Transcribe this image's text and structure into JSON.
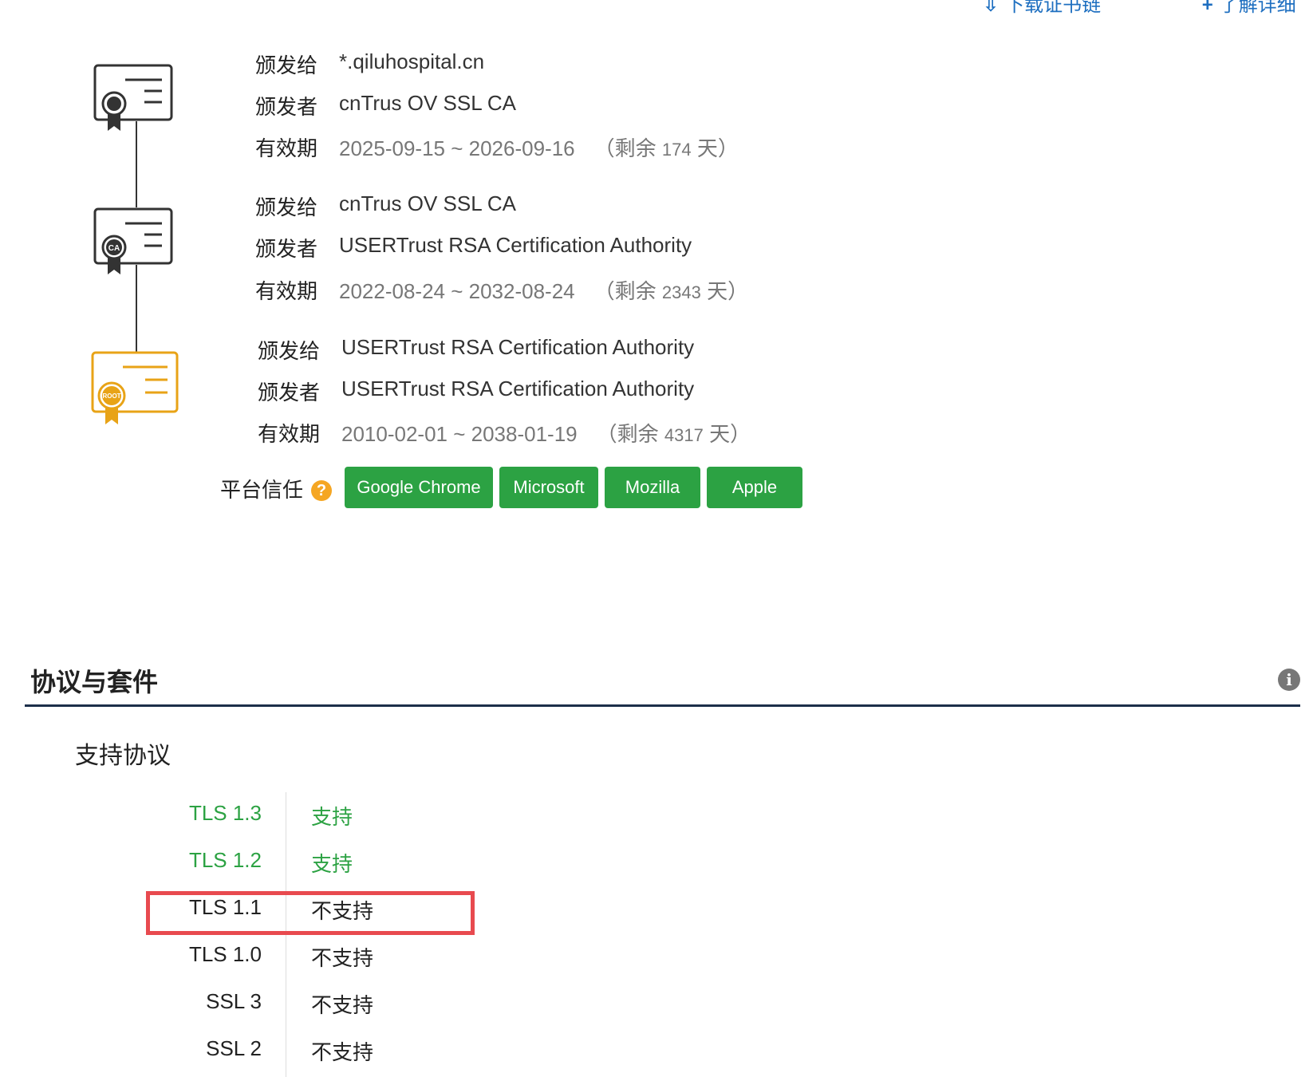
{
  "top_links": [
    {
      "icon": "download-icon",
      "label": "下载证书链"
    },
    {
      "icon": "plus-icon",
      "label": "了解详细"
    }
  ],
  "chain": [
    {
      "icon": "certificate-icon",
      "rows": [
        {
          "label": "颁发给",
          "value": "*.qiluhospital.cn"
        },
        {
          "label": "颁发者",
          "value": "cnTrus OV SSL CA"
        },
        {
          "label": "有效期",
          "value": "2025-09-15 ~ 2026-09-16",
          "remain_prefix": "（剩余",
          "remain_days": "174",
          "remain_suffix": "天）"
        }
      ]
    },
    {
      "icon": "ca-certificate-icon",
      "seal": "CA",
      "rows": [
        {
          "label": "颁发给",
          "value": "cnTrus OV SSL CA"
        },
        {
          "label": "颁发者",
          "value": "USERTrust RSA Certification Authority"
        },
        {
          "label": "有效期",
          "value": "2022-08-24 ~ 2032-08-24",
          "remain_prefix": "（剩余",
          "remain_days": "2343",
          "remain_suffix": "天）"
        }
      ]
    },
    {
      "icon": "root-certificate-icon",
      "seal": "ROOT",
      "rows": [
        {
          "label": "颁发给",
          "value": "USERTrust RSA Certification Authority"
        },
        {
          "label": "颁发者",
          "value": "USERTrust RSA Certification Authority"
        },
        {
          "label": "有效期",
          "value": "2010-02-01 ~ 2038-01-19",
          "remain_prefix": "（剩余",
          "remain_days": "4317",
          "remain_suffix": "天）"
        }
      ]
    }
  ],
  "trust": {
    "label": "平台信任",
    "help_glyph": "?",
    "platforms": [
      "Google Chrome",
      "Microsoft",
      "Mozilla",
      "Apple"
    ]
  },
  "section": {
    "title": "协议与套件",
    "info_glyph": "i",
    "subtitle": "支持协议"
  },
  "protocols": [
    {
      "name": "TLS 1.3",
      "status": "支持",
      "supported": true
    },
    {
      "name": "TLS 1.2",
      "status": "支持",
      "supported": true
    },
    {
      "name": "TLS 1.1",
      "status": "不支持",
      "supported": false,
      "highlighted": true
    },
    {
      "name": "TLS 1.0",
      "status": "不支持",
      "supported": false
    },
    {
      "name": "SSL 3",
      "status": "不支持",
      "supported": false
    },
    {
      "name": "SSL 2",
      "status": "不支持",
      "supported": false
    }
  ],
  "colors": {
    "link": "#1e6fc0",
    "badge_green": "#2ca243",
    "root_gold": "#e8a317",
    "highlight_red": "#e84a4f",
    "rule_navy": "#1c2f4a"
  }
}
